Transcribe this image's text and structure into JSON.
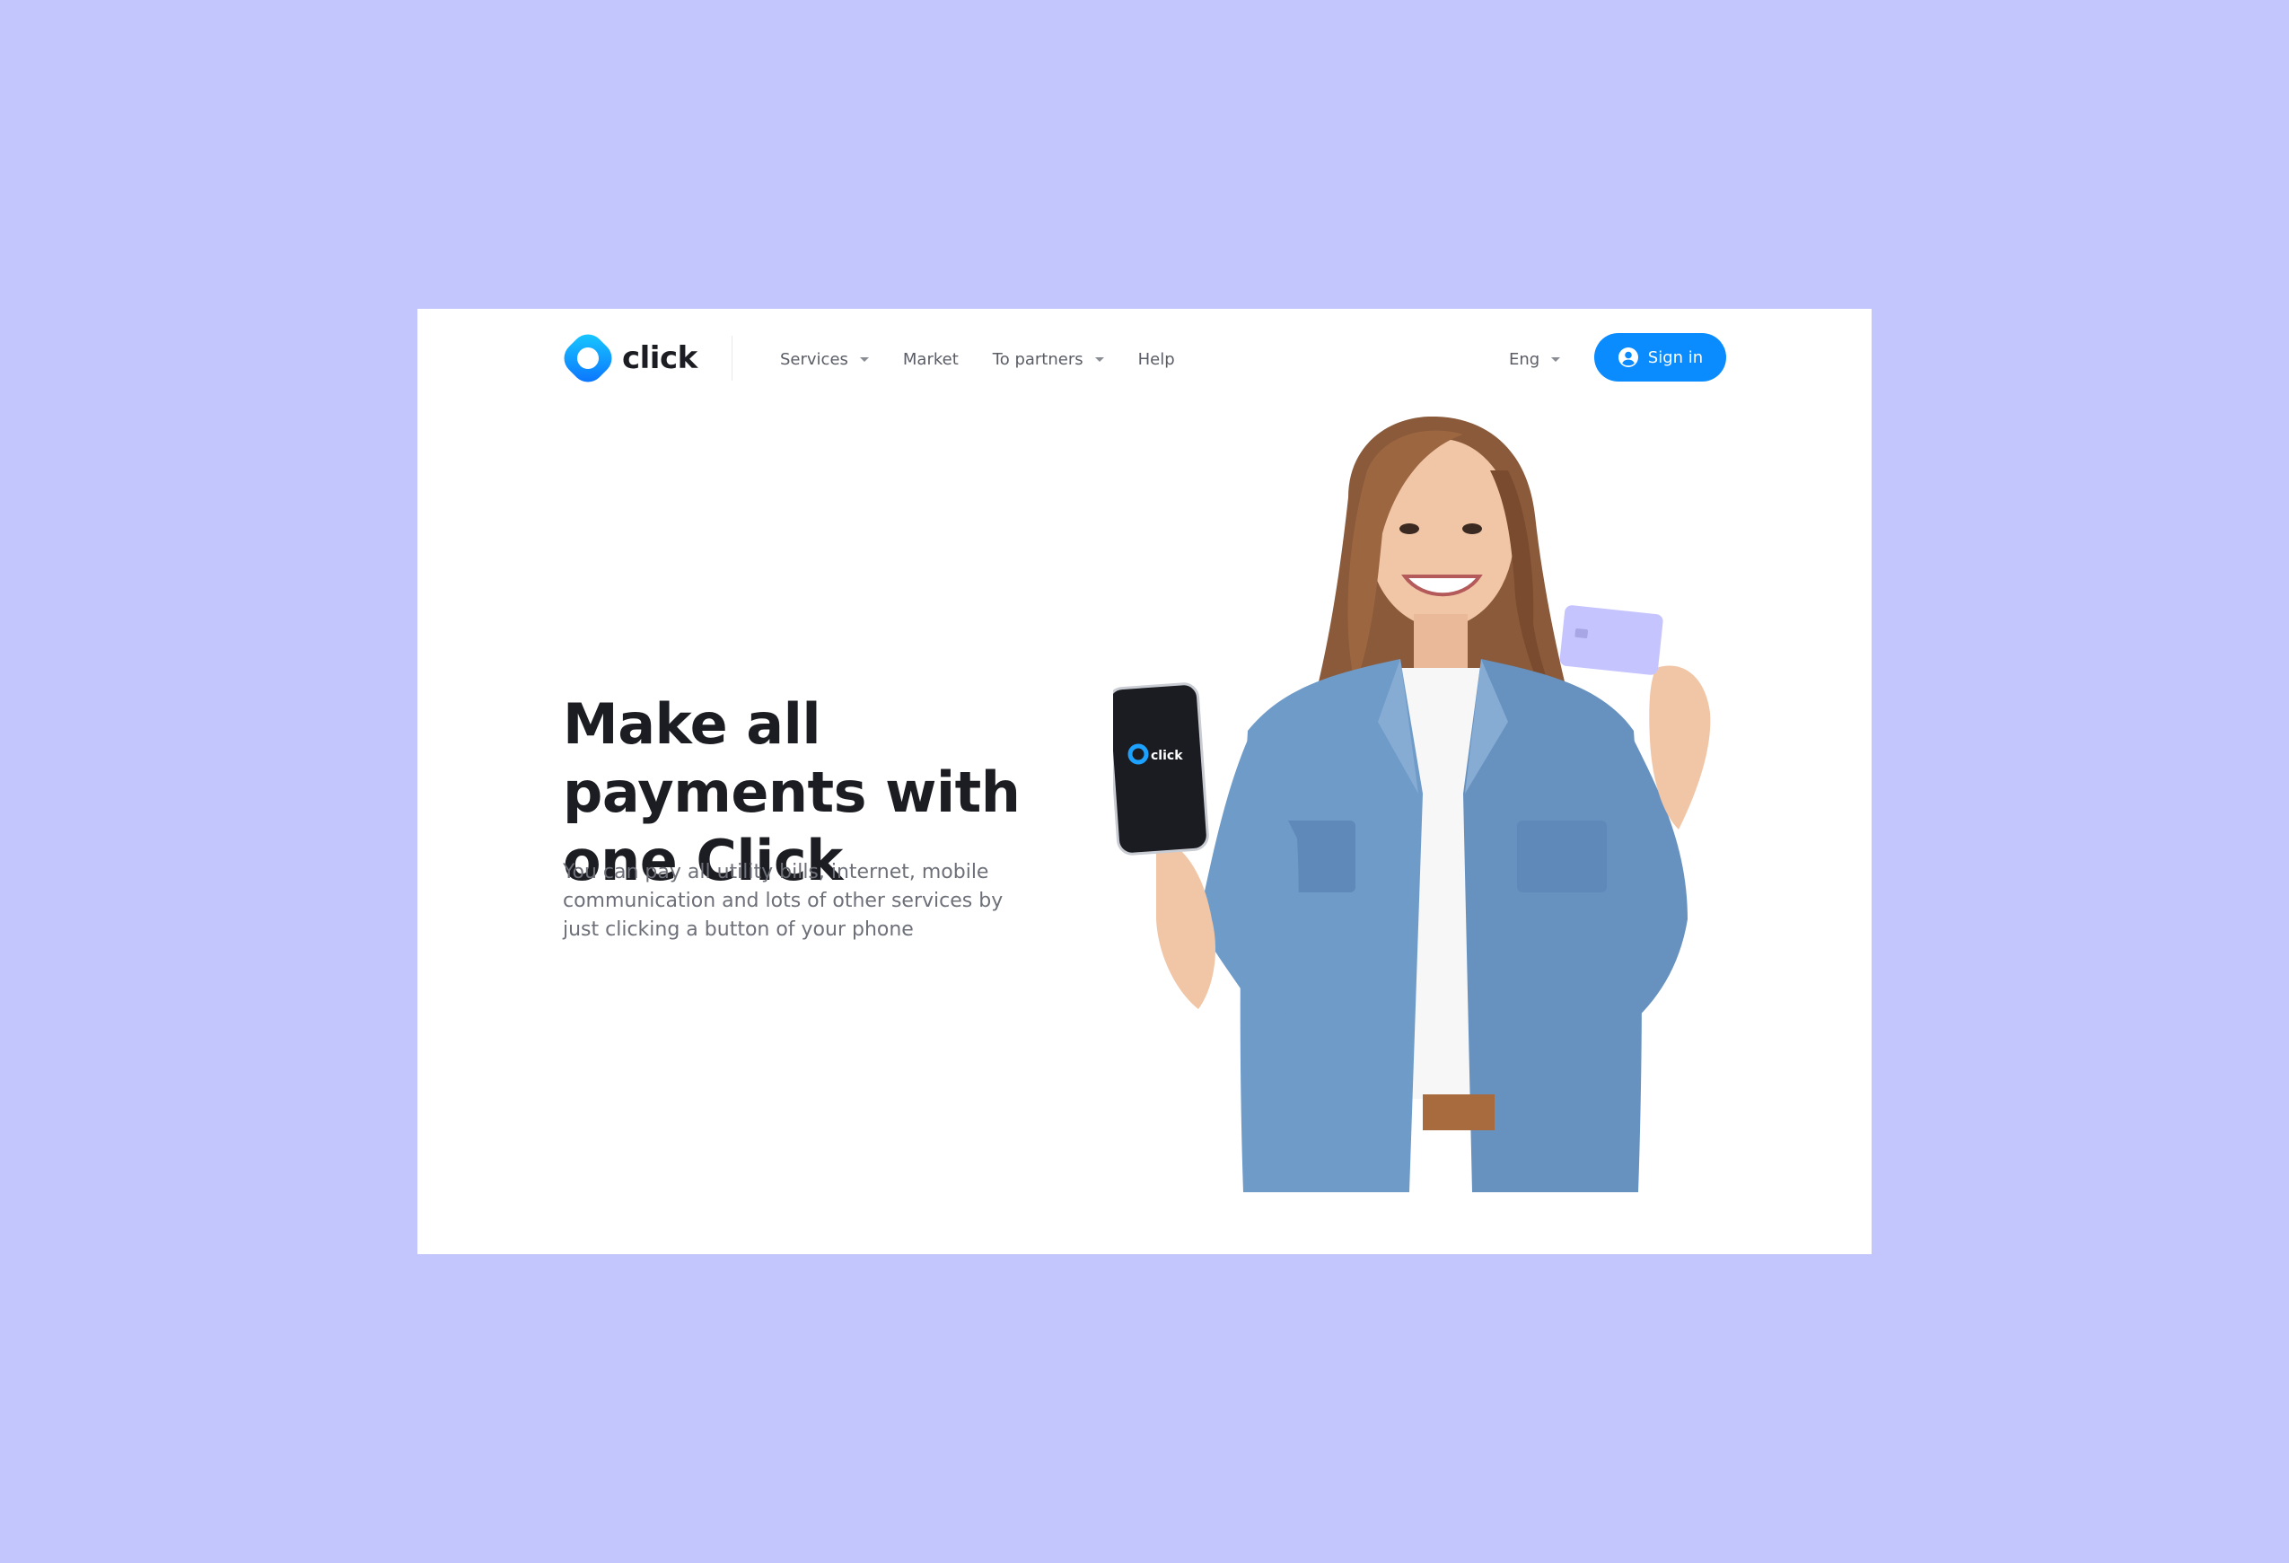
{
  "brand": {
    "name": "click",
    "accent_color": "#0a8cff",
    "background_color": "#c2c6fd"
  },
  "nav": {
    "items": [
      {
        "label": "Services",
        "has_dropdown": true
      },
      {
        "label": "Market",
        "has_dropdown": false
      },
      {
        "label": "To partners",
        "has_dropdown": true
      },
      {
        "label": "Help",
        "has_dropdown": false
      }
    ]
  },
  "language": {
    "selected": "Eng"
  },
  "auth": {
    "signin_label": "Sign in",
    "icon": "user-circle-icon"
  },
  "hero": {
    "title": "Make all payments with one Click",
    "subtitle": "You can pay all utility bills, internet, mobile communication and lots of other services by just clicking a button of your phone",
    "phone_logo_text": "click"
  }
}
